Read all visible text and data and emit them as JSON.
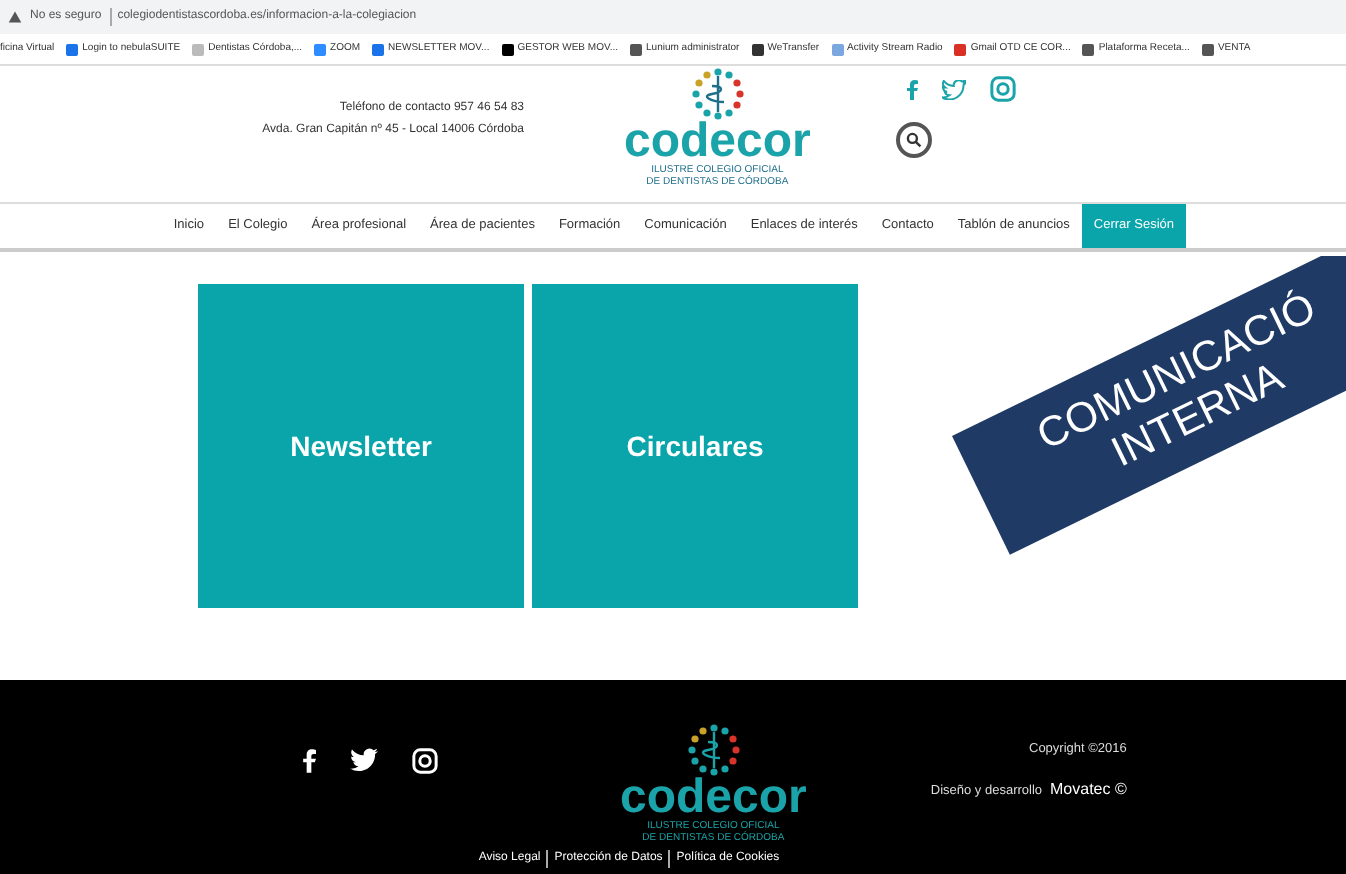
{
  "browser": {
    "security": "No es seguro",
    "url": "colegiodentistascordoba.es/informacion-a-la-colegiacion",
    "bookmarks": [
      "ficina Virtual",
      "Login to nebulaSUITE",
      "Dentistas Córdoba,...",
      "ZOOM",
      "NEWSLETTER MOV...",
      "GESTOR WEB MOV...",
      "Lunium administrator",
      "WeTransfer",
      "Activity Stream Radio",
      "Gmail OTD CE COR...",
      "Plataforma Receta...",
      "VENTA"
    ]
  },
  "header": {
    "contact": [
      "Teléfono de contacto 957 46 54 83",
      "Avda. Gran Capitán nº 45 - Local 14006 Córdoba"
    ],
    "logo": {
      "name": "codecor",
      "subtitle": [
        "ILUSTRE COLEGIO OFICIAL",
        "DE DENTISTAS DE CÓRDOBA"
      ]
    }
  },
  "nav": [
    {
      "label": "Inicio",
      "selected": false
    },
    {
      "label": "El Colegio",
      "selected": false
    },
    {
      "label": "Área profesional",
      "selected": false
    },
    {
      "label": "Área de pacientes",
      "selected": false
    },
    {
      "label": "Formación",
      "selected": false
    },
    {
      "label": "Comunicación",
      "selected": false
    },
    {
      "label": "Enlaces de interés",
      "selected": false
    },
    {
      "label": "Contacto",
      "selected": false
    },
    {
      "label": "Tablón de anuncios",
      "selected": false
    },
    {
      "label": "Cerrar Sesión",
      "selected": true
    }
  ],
  "tiles": [
    "Newsletter",
    "Circulares"
  ],
  "banner": [
    "COMUNICACIÓ",
    "INTERNA"
  ],
  "footer": {
    "logo": {
      "name": "codecor",
      "subtitle": [
        "ILUSTRE COLEGIO OFICIAL",
        "DE DENTISTAS DE CÓRDOBA"
      ]
    },
    "copyright": "Copyright ©2016",
    "credit": "Diseño y desarrollo",
    "company": "Movatec ©",
    "links": [
      "Aviso Legal",
      "Protección de Datos",
      "Política de Cookies"
    ]
  }
}
